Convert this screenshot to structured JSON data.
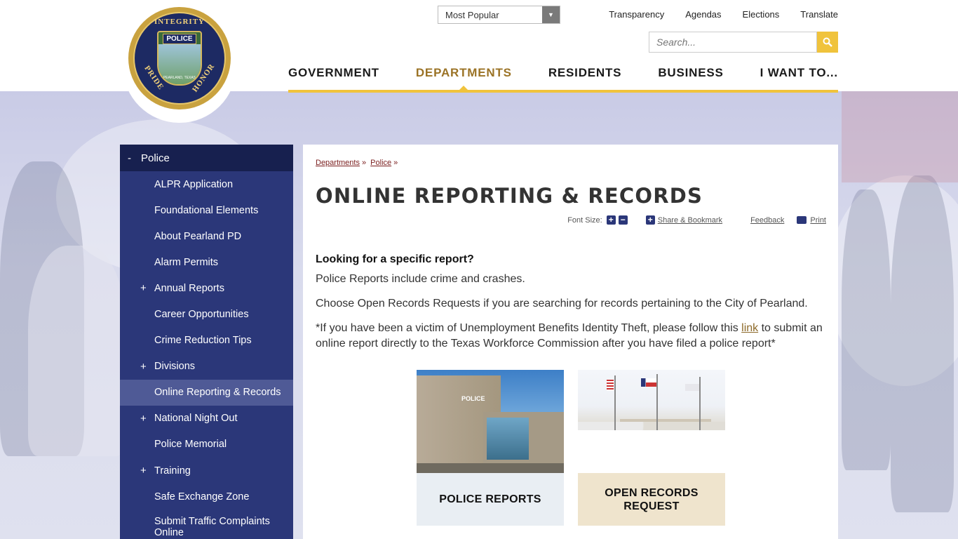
{
  "header": {
    "logo": {
      "top_word": "INTEGRITY",
      "left_word": "PRIDE",
      "right_word": "HONOR",
      "center_banner": "POLICE",
      "small_text": "PEARLAND, TEXAS"
    },
    "quick_select": {
      "selected": "Most Popular"
    },
    "utility_links": [
      "Transparency",
      "Agendas",
      "Elections",
      "Translate"
    ],
    "search": {
      "placeholder": "Search..."
    },
    "main_nav": [
      {
        "label": "GOVERNMENT",
        "active": false
      },
      {
        "label": "DEPARTMENTS",
        "active": true
      },
      {
        "label": "RESIDENTS",
        "active": false
      },
      {
        "label": "BUSINESS",
        "active": false
      },
      {
        "label": "I WANT TO...",
        "active": false
      }
    ]
  },
  "sidebar": {
    "heading": "Police",
    "heading_toggle": "-",
    "items": [
      {
        "label": "ALPR Application",
        "expandable": false
      },
      {
        "label": "Foundational Elements",
        "expandable": false
      },
      {
        "label": "About Pearland PD",
        "expandable": false
      },
      {
        "label": "Alarm Permits",
        "expandable": false
      },
      {
        "label": "Annual Reports",
        "expandable": true
      },
      {
        "label": "Career Opportunities",
        "expandable": false
      },
      {
        "label": "Crime Reduction Tips",
        "expandable": false
      },
      {
        "label": "Divisions",
        "expandable": true
      },
      {
        "label": "Online Reporting & Records",
        "expandable": false,
        "active": true
      },
      {
        "label": "National Night Out",
        "expandable": true
      },
      {
        "label": "Police Memorial",
        "expandable": false
      },
      {
        "label": "Training",
        "expandable": true
      },
      {
        "label": "Safe Exchange Zone",
        "expandable": false
      },
      {
        "label": "Submit Traffic Complaints Online",
        "expandable": false
      }
    ],
    "plus_symbol": "+"
  },
  "content": {
    "breadcrumb": [
      "Departments",
      "Police"
    ],
    "breadcrumb_sep": "»",
    "title": "ONLINE REPORTING & RECORDS",
    "tools": {
      "font_size_label": "Font Size:",
      "plus": "+",
      "minus": "−",
      "share": "Share & Bookmark",
      "feedback": "Feedback",
      "print": "Print"
    },
    "heading": "Looking for a specific report?",
    "p1": "Police Reports include crime and crashes.",
    "p2": "Choose Open Records Requests if you are searching for records pertaining to the City of Pearland.",
    "p3_before": "*If you have been a victim of Unemployment Benefits Identity Theft, please follow this ",
    "p3_link": "link",
    "p3_after": " to submit an online report directly to the Texas Workforce Commission after you have filed a police report*",
    "cards": [
      {
        "label": "POLICE REPORTS",
        "photo_sign": "POLICE"
      },
      {
        "label": "OPEN RECORDS REQUEST"
      }
    ]
  },
  "colors": {
    "navy": "#2b3779",
    "navy_dark": "#17204f",
    "gold": "#f0c33c",
    "nav_active": "#9b7326"
  }
}
